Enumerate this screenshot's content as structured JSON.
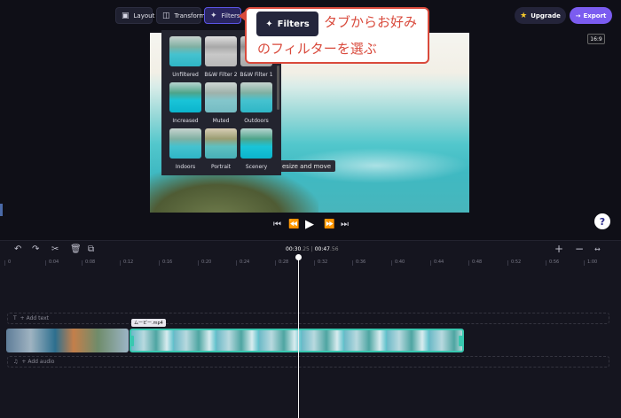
{
  "toolbar": {
    "layout_label": "Layout",
    "transform_label": "Transform",
    "filters_label": "Filters",
    "upgrade_label": "Upgrade",
    "export_label": "Export"
  },
  "callout": {
    "pill_label": "Filters",
    "line1": "タブからお好み",
    "line2": "のフィルターを選ぶ"
  },
  "filters": [
    {
      "label": "Unfiltered"
    },
    {
      "label": "B&W Filter 2"
    },
    {
      "label": "B&W Filter 1"
    },
    {
      "label": "Increased"
    },
    {
      "label": "Muted"
    },
    {
      "label": "Outdoors"
    },
    {
      "label": "Indoors"
    },
    {
      "label": "Portrait"
    },
    {
      "label": "Scenery"
    }
  ],
  "preview": {
    "tooltip": "esize and move",
    "aspect_ratio": "16:9"
  },
  "timeline": {
    "current_time": "00:30",
    "current_frac": ".25",
    "separator": " | ",
    "total_time": "00:47",
    "total_frac": ".56",
    "ruler_ticks": [
      "0",
      "0:04",
      "0:08",
      "0:12",
      "0:16",
      "0:20",
      "0:24",
      "0:28",
      "0:32",
      "0:36",
      "0:40",
      "0:44",
      "0:48",
      "0:52",
      "0:56",
      "1:00"
    ],
    "text_track_label": "+ Add text",
    "audio_track_label": "+ Add audio",
    "clip_label": "ムービー.mp4"
  },
  "colors": {
    "accent": "#7b5cf0",
    "callout_red": "#d94a3c",
    "clip_selected": "#39c8b0"
  }
}
